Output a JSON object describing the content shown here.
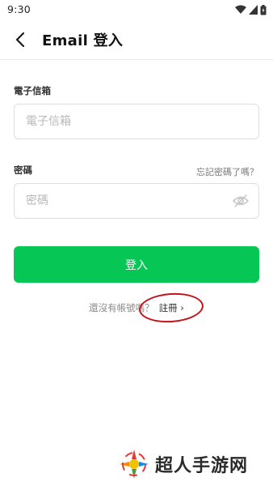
{
  "status_bar": {
    "time": "9:30"
  },
  "header": {
    "title": "Email 登入"
  },
  "form": {
    "email_label": "電子信箱",
    "email_placeholder": "電子信箱",
    "password_label": "密碼",
    "password_placeholder": "密碼",
    "forgot_password": "忘記密碼了嗎？",
    "login_button": "登入"
  },
  "signup": {
    "prompt": "還沒有帳號嗎？",
    "link": "註冊 ›"
  },
  "watermark": {
    "text": "超人手游网"
  },
  "colors": {
    "accent": "#06c755",
    "annotation": "#c4141b"
  }
}
